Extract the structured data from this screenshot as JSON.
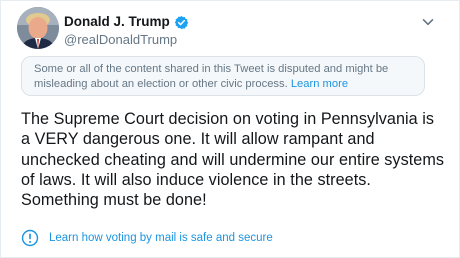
{
  "tweet": {
    "author": {
      "display_name": "Donald J. Trump",
      "handle": "@realDonaldTrump",
      "verified": true,
      "avatar_icon": "profile-photo"
    },
    "menu_icon": "chevron-down-icon",
    "notice": {
      "text": "Some or all of the content shared in this Tweet is disputed and might be misleading about an election or other civic process.",
      "link_label": "Learn more"
    },
    "body": "The Supreme Court decision on voting in Pennsylvania is a VERY dangerous one. It will allow rampant and unchecked cheating and will undermine our entire systems of laws. It will also induce violence in the streets. Something must be done!",
    "info_link": {
      "icon": "info-icon",
      "label": "Learn how voting by mail is safe and secure"
    }
  },
  "colors": {
    "text": "#14171a",
    "secondary_text": "#657786",
    "link": "#1b95e0",
    "notice_bg": "#f5f8fa",
    "verified_badge": "#1da1f2"
  }
}
